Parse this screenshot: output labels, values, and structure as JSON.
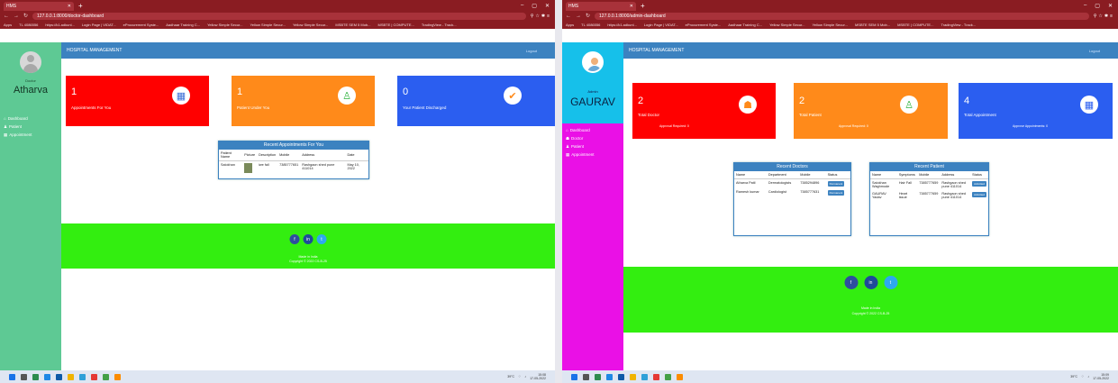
{
  "left": {
    "tab_title": "HMS",
    "url": "127.0.0.1:8000/doctor-dashboard",
    "bookmarks": [
      "Apps",
      "TL 4086556",
      "https://k1.adkunl...",
      "Login Page | VIDAT...",
      "eProcurement Syste...",
      "Aadhaar Training C...",
      "Yellow Simple Secur...",
      "Yellow Simple Secur...",
      "Yellow Simple Secur...",
      "MSBTE SEM 5 Mob...",
      "MSBTE | COMPUTE...",
      "TradingView - Track..."
    ],
    "sidebar": {
      "role": "Doctor",
      "username": "Atharva",
      "menu": [
        {
          "icon": "dashboard-icon",
          "glyph": "⌂",
          "label": "Dashboard"
        },
        {
          "icon": "patient-icon",
          "glyph": "♟",
          "label": "Patient"
        },
        {
          "icon": "calendar-icon",
          "glyph": "▦",
          "label": "Appointment"
        }
      ]
    },
    "topnav": {
      "title": "HOSPITAL MANAGEMENT",
      "logout": "Logout"
    },
    "cards": [
      {
        "number": "1",
        "label": "Appointments For You",
        "icon": "calendar-icon",
        "glyph": "▦",
        "color": "#ff0000"
      },
      {
        "number": "1",
        "label": "Patient Under You",
        "icon": "user-icon",
        "glyph": "♙",
        "color": "#ff8a1a"
      },
      {
        "number": "0",
        "label": "Your Patient Discharged",
        "icon": "check-circle-icon",
        "glyph": "✔",
        "color": "#2b5ef0"
      }
    ],
    "recent_appointments": {
      "title": "Recent Appointments For You",
      "columns": [
        "Patient Name",
        "Picture",
        "Description",
        "Mobile",
        "Address",
        "Date"
      ],
      "rows": [
        {
          "name": "Salokhan",
          "description": "iwe fall",
          "mobile": "7385777651",
          "address": "Rashgaon shed pune 411014",
          "date": "May 10, 2022"
        }
      ]
    },
    "footer": {
      "social": [
        "f",
        "in",
        "t"
      ],
      "line1": "Made in India",
      "line2": "Copyright © 2022 CS-B-25"
    }
  },
  "right": {
    "tab_title": "HMS",
    "url": "127.0.0.1:8000/admin-dashboard",
    "bookmarks": [
      "Apps",
      "TL 4086556",
      "https://k1.adkunl...",
      "Login Page | VIDAT...",
      "eProcurement Syste...",
      "Aadhaar Training C...",
      "Yellow Simple Secur...",
      "Yellow Simple Secur...",
      "MSBTE SEM 5 Mob...",
      "MSBTE | COMPUTE...",
      "TradingView - Track..."
    ],
    "sidebar": {
      "role": "Admin",
      "username": "GAURAV",
      "menu": [
        {
          "icon": "dashboard-icon",
          "glyph": "⌂",
          "label": "Dashboard"
        },
        {
          "icon": "doctor-icon",
          "glyph": "☗",
          "label": "Doctor"
        },
        {
          "icon": "patient-icon",
          "glyph": "♟",
          "label": "Patient"
        },
        {
          "icon": "calendar-icon",
          "glyph": "▦",
          "label": "Appointment"
        }
      ]
    },
    "topnav": {
      "title": "HOSPITAL MANAGEMENT",
      "logout": "Logout"
    },
    "cards": [
      {
        "number": "2",
        "label": "Total Doctor",
        "sub": "Approval Required: 0",
        "icon": "doctor-icon",
        "glyph": "☗",
        "color": "#ff0000"
      },
      {
        "number": "2",
        "label": "Total Patient",
        "sub": "Approval Required: 0",
        "icon": "user-icon",
        "glyph": "♙",
        "color": "#ff8a1a"
      },
      {
        "number": "4",
        "label": "Total Appointment",
        "sub": "Approve Appointments: 0",
        "icon": "calendar-icon",
        "glyph": "▦",
        "color": "#2b5ef0"
      }
    ],
    "recent_doctors": {
      "title": "Recent Doctors",
      "columns": [
        "Name",
        "Department",
        "Mobile",
        "Status"
      ],
      "rows": [
        {
          "name": "Atharva Patil",
          "department": "Dermatologists",
          "mobile": "7385294896",
          "status": "Permanent"
        },
        {
          "name": "Ramesh kumar",
          "department": "Cardiologist",
          "mobile": "7385777631",
          "status": "Permanent"
        }
      ]
    },
    "recent_patients": {
      "title": "Recent Patient",
      "columns": [
        "Name",
        "Symptoms",
        "Mobile",
        "Address",
        "Status"
      ],
      "rows": [
        {
          "name": "Salokhan Waghmode",
          "symptoms": "Hair Fall",
          "mobile": "7385777659",
          "address": "Rashgaon shed pune 411014",
          "status": "Admitted"
        },
        {
          "name": "GAURAV Yadav",
          "symptoms": "Heart issue",
          "mobile": "7385777659",
          "address": "Rashgaon shed pune 411014",
          "status": "Admitted"
        }
      ]
    },
    "footer": {
      "social": [
        "f",
        "in",
        "t"
      ],
      "line1": "Made in India",
      "line2": "Copyright © 2022 CS-B-25"
    }
  },
  "taskbar": {
    "temp": "39°C",
    "left_clock_time": "15:08",
    "left_clock_date": "17-05-2022",
    "right_clock_time": "15:09",
    "right_clock_date": "17-05-2022"
  }
}
